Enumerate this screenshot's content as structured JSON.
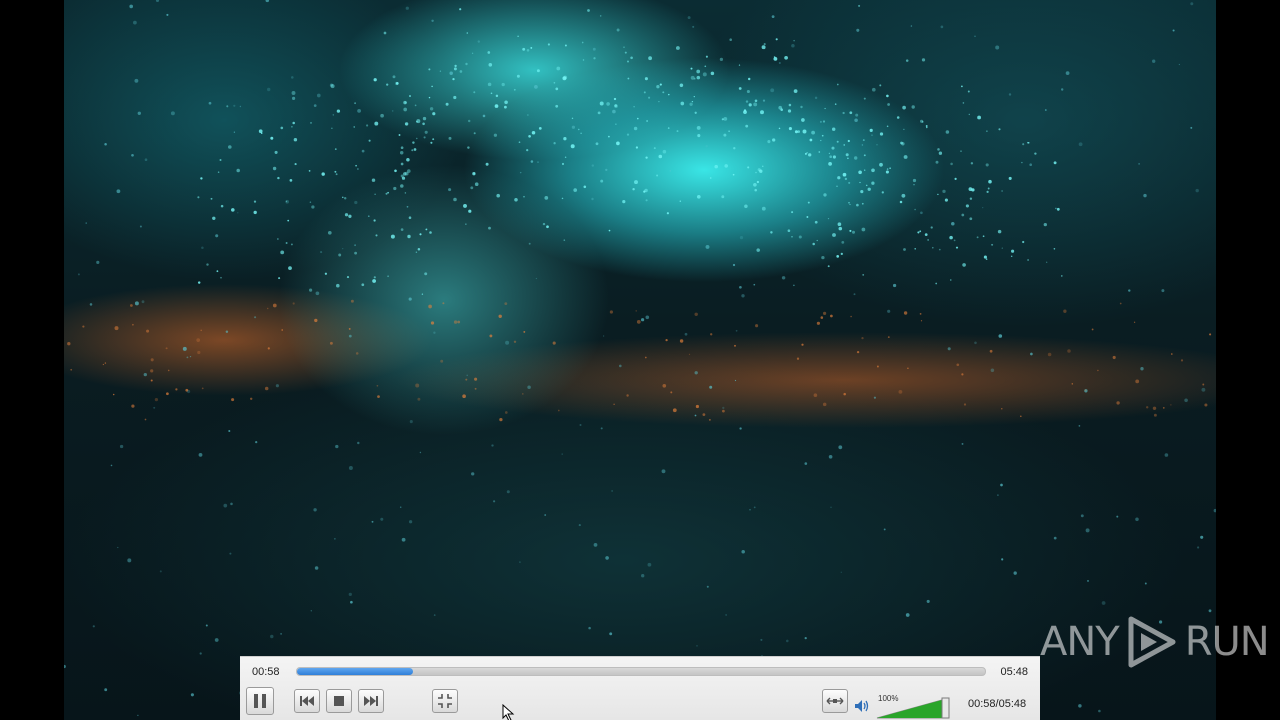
{
  "player": {
    "elapsed": "00:58",
    "duration": "05:48",
    "progress_fraction": 0.168,
    "time_display": "00:58/05:48",
    "volume_label": "100%",
    "volume_fraction": 1.0,
    "accent_color": "#2f7fd8",
    "volume_color": "#2aa52a"
  },
  "icons": {
    "play_pause": "pause-icon",
    "previous": "previous-icon",
    "stop": "stop-icon",
    "next": "next-icon",
    "fullscreen": "fullscreen-icon",
    "extended": "extended-settings-icon",
    "speaker": "speaker-icon"
  },
  "watermark": {
    "text_left": "ANY",
    "text_right": "RUN"
  }
}
